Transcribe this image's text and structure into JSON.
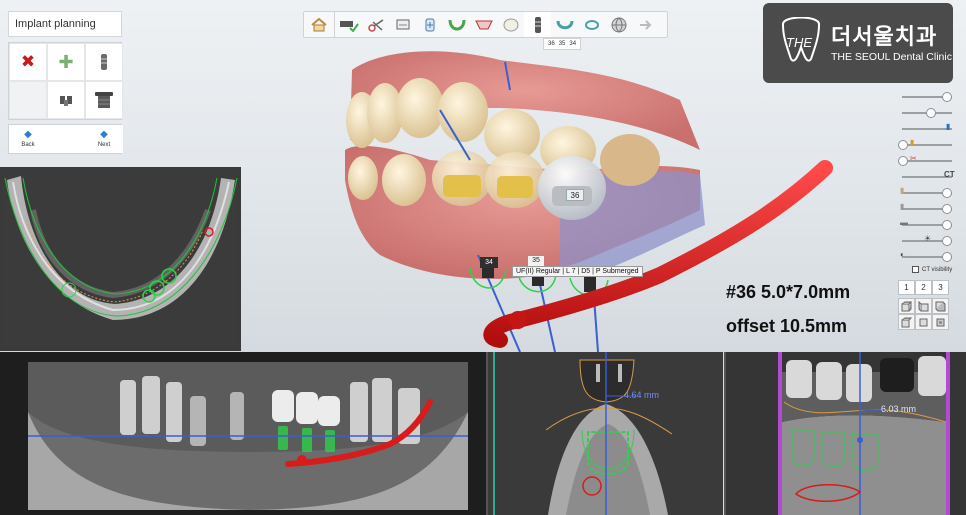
{
  "app": {
    "planning_title": "Implant planning",
    "nav": {
      "back_label": "Back",
      "next_label": "Next"
    }
  },
  "tools": [
    {
      "name": "delete-implant",
      "icon": "red-x-icon"
    },
    {
      "name": "add-implant",
      "icon": "plus-icon"
    },
    {
      "name": "implant-fixture",
      "icon": "implant-icon"
    },
    {
      "name": "empty-slot",
      "icon": ""
    },
    {
      "name": "abutment",
      "icon": "abutment-icon"
    },
    {
      "name": "sleeve",
      "icon": "sleeve-icon"
    }
  ],
  "toolbar": {
    "steps": [
      "home",
      "scan-check",
      "segment",
      "align",
      "tooth-setup",
      "arch",
      "crown-design",
      "tooth-library",
      "implant",
      "guide",
      "sleeve-ring",
      "export",
      "next-disabled"
    ],
    "active_step": "implant",
    "tooth_indicator": [
      "36",
      "35",
      "34"
    ]
  },
  "logo": {
    "korean": "더서울치과",
    "english": "THE SEOUL Dental Clinic",
    "mark": "THE"
  },
  "side_controls": {
    "ct_label": "CT",
    "ct_visibility_label": "CT visibility",
    "view_tabs": [
      "1",
      "2",
      "3"
    ]
  },
  "scene_labels": {
    "tooth_36": "36",
    "implant_34": "34",
    "implant_35": "35",
    "implant_tooltip": "UF(II) Regular | L 7 | D5 | P Submerged"
  },
  "annotations": {
    "implant_spec": "#36 5.0*7.0mm",
    "offset": "offset 10.5mm"
  },
  "measurements": {
    "cross_section_1": "4.64 mm",
    "cross_section_2": "6.03 mm"
  },
  "colors": {
    "nerve": "#d81c1c",
    "implant_outline": "#2fd04a",
    "canal_line": "#3a5fd0",
    "logo_bg": "#4b4b4b"
  }
}
